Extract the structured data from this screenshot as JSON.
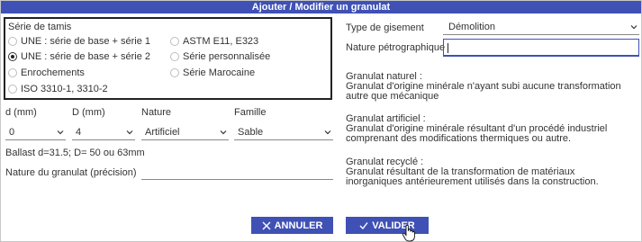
{
  "dialog": {
    "title": "Ajouter / Modifier un granulat"
  },
  "sieve": {
    "title": "Série de tamis",
    "options": [
      {
        "label": "UNE : série de base + série 1",
        "checked": false
      },
      {
        "label": "ASTM E11, E323",
        "checked": false
      },
      {
        "label": "UNE : série de base + série 2",
        "checked": true
      },
      {
        "label": "Série personnalisée",
        "checked": false
      },
      {
        "label": "Enrochements",
        "checked": false
      },
      {
        "label": "Série Marocaine",
        "checked": false
      },
      {
        "label": "ISO 3310-1, 3310-2",
        "checked": false
      }
    ]
  },
  "fields": {
    "d_label": "d (mm)",
    "D_label": "D (mm)",
    "nature_label": "Nature",
    "famille_label": "Famille",
    "d_value": "0",
    "D_value": "4",
    "nature_value": "Artificiel",
    "famille_value": "Sable",
    "ballast_note": "Ballast d=31.5; D= 50 ou 63mm",
    "nature_granulat_label": "Nature du granulat (précision)",
    "nature_granulat_value": ""
  },
  "right": {
    "type_gisement_label": "Type de gisement",
    "type_gisement_value": "Démolition",
    "nature_petro_label": "Nature pétrographique",
    "nature_petro_value": "",
    "naturel_title": "Granulat naturel :",
    "naturel_text": "Granulat d'origine minérale n'ayant subi aucune transformation autre que mécanique",
    "artificiel_title": "Granulat artificiel :",
    "artificiel_text": "Granulat d'origine minérale résultant d'un procédé industriel comprenant des modifications thermiques ou autre.",
    "recycle_title": "Granulat recyclé :",
    "recycle_text": "Granulat résultant de la transformation de matériaux inorganiques antérieurement utilisés dans la construction."
  },
  "buttons": {
    "cancel_label": "ANNULER",
    "validate_label": "VALIDER"
  },
  "colors": {
    "primary": "#3f51b5",
    "text": "#333333"
  }
}
